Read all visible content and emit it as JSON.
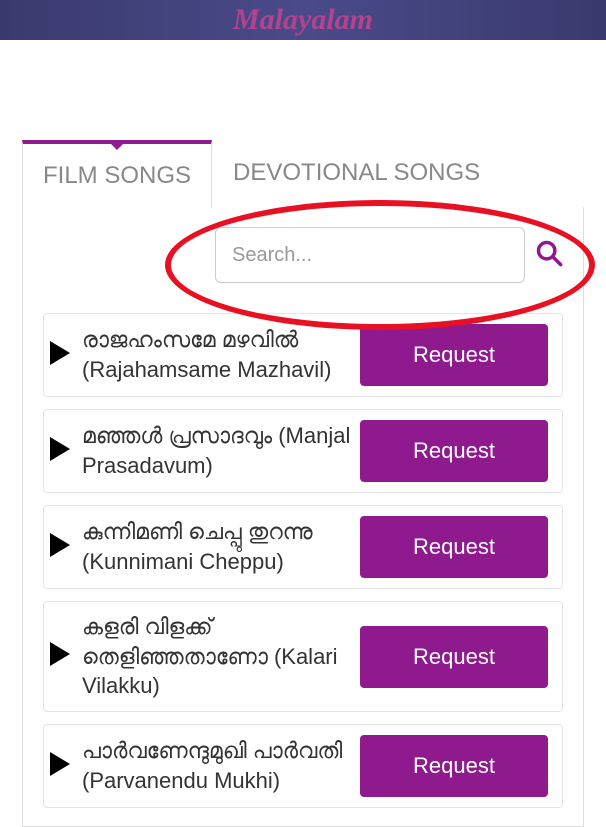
{
  "header": {
    "title": "Malayalam"
  },
  "tabs": {
    "film": "FILM SONGS",
    "devotional": "DEVOTIONAL SONGS"
  },
  "search": {
    "placeholder": "Search..."
  },
  "buttons": {
    "request": "Request"
  },
  "songs": [
    {
      "title": "രാജഹംസമേ മഴവിൽ (Rajahamsame Mazhavil)"
    },
    {
      "title": "മഞ്ഞൾ പ്രസാദവും (Manjal Prasadavum)"
    },
    {
      "title": "കുന്നിമണി ചെപ്പു തുറന്നു (Kunnimani Cheppu)"
    },
    {
      "title": "കളരി വിളക്ക് തെളിഞ്ഞതാണോ (Kalari Vilakku)"
    },
    {
      "title": "പാർവണേന്ദുമുഖി പാർവതി (Parvanendu Mukhi)"
    }
  ]
}
